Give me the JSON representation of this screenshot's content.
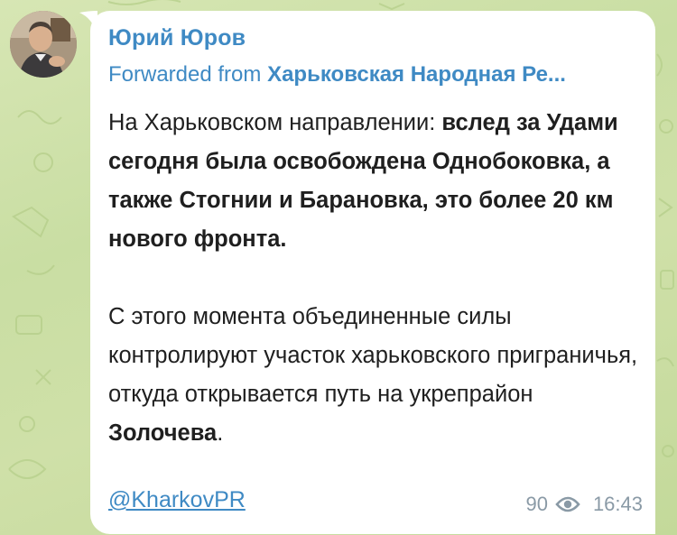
{
  "message": {
    "sender_name": "Юрий Юров",
    "forward_prefix": "Forwarded from",
    "forward_source": "Харьковская Народная Ре...",
    "paragraph1": {
      "normal_start": "На Харьковском направлении: ",
      "bold_rest": "вслед за Удами сегодня была освобождена Однобоковка, а также Стогнии и Барановка, это более 20 км нового фронта."
    },
    "paragraph2": {
      "normal_start": "С этого момента объединенные силы контролируют участок харьковского приграничья, откуда открывается путь на укрепрайон ",
      "bold_word": "Золочева",
      "end": "."
    },
    "hashtag": "@KharkovPR",
    "views": "90",
    "time": "16:43"
  },
  "icons": {
    "views_icon": "eye-icon",
    "avatar": "profile-photo"
  },
  "colors": {
    "link": "#3f8ac4",
    "meta": "#8a9aa6",
    "text": "#1f1f1f",
    "background": "#cfe0a8"
  }
}
